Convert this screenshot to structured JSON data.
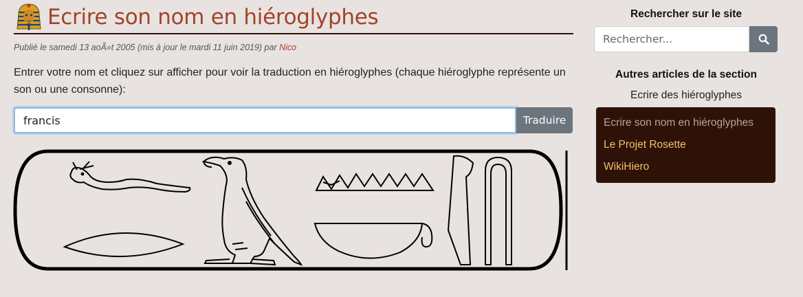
{
  "article": {
    "title": "Ecrire son nom en hiéroglyphes",
    "meta_prefix": "Publié le samedi 13 aoÃ»t 2005 (mis à jour le mardi 11 juin 2019) par ",
    "author": "Nico",
    "intro": "Entrer votre nom et cliquez sur afficher pour voir la traduction en hiéroglyphes (chaque hiéroglyphe représente un son ou une consonne):",
    "name_value": "francis",
    "translate_label": "Traduire"
  },
  "sidebar": {
    "search_heading": "Rechercher sur le site",
    "search_placeholder": "Rechercher...",
    "section_heading": "Autres articles de la section",
    "section_name": "Ecrire des hiéroglyphes",
    "articles": [
      {
        "label": "Ecrire son nom en hiéroglyphes",
        "current": true
      },
      {
        "label": "Le Projet Rosette",
        "current": false
      },
      {
        "label": "WikiHiero",
        "current": false
      }
    ]
  },
  "icons": {
    "search": "search-icon",
    "pharaoh": "pharaoh-mask-icon"
  },
  "colors": {
    "background": "#e8e3e1",
    "title": "#a3432a",
    "button": "#6c757d",
    "nav_background": "#2e1208",
    "nav_link": "#f0c26c"
  }
}
